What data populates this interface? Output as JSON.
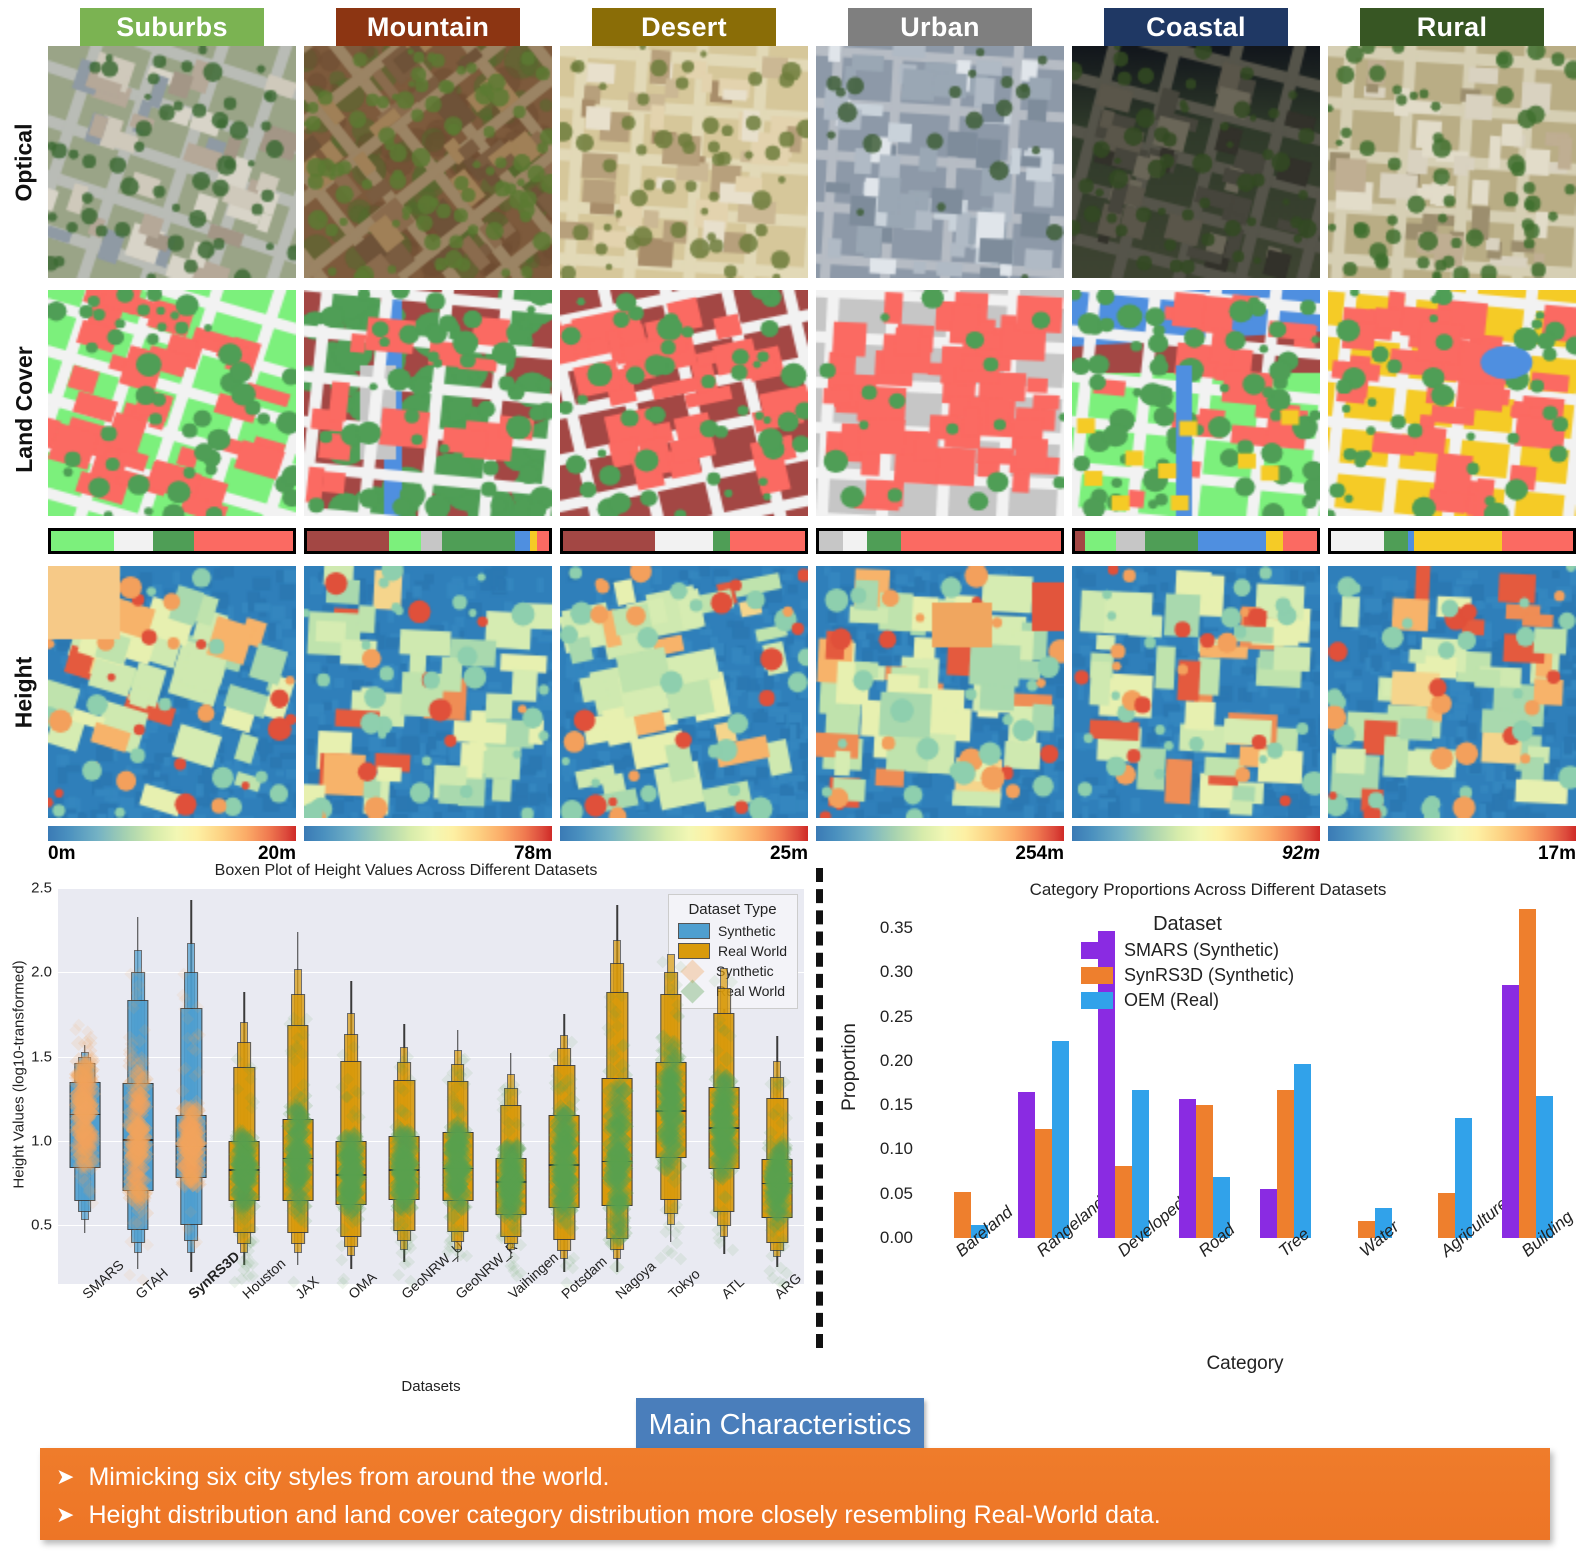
{
  "grid": {
    "row_labels": [
      "Optical",
      "Land Cover",
      "Height"
    ],
    "columns": [
      {
        "name": "Suburbs",
        "color": "#7bb352",
        "height_min": "0m",
        "height_max": "20m",
        "legend": [
          [
            "#7cf07c",
            0.26
          ],
          [
            "#f2f2f2",
            0.16
          ],
          [
            "#4f9e56",
            0.17
          ],
          [
            "#fb6a62",
            0.41
          ]
        ]
      },
      {
        "name": "Mountain",
        "color": "#8c3512",
        "height_min": "",
        "height_max": "78m",
        "legend": [
          [
            "#a34744",
            0.34
          ],
          [
            "#7cf07c",
            0.13
          ],
          [
            "#c6c6c6",
            0.09
          ],
          [
            "#4f9e56",
            0.3
          ],
          [
            "#4f8fe0",
            0.06
          ],
          [
            "#f5cb26",
            0.03
          ],
          [
            "#fb6a62",
            0.05
          ]
        ]
      },
      {
        "name": "Desert",
        "color": "#8a6d07",
        "height_min": "",
        "height_max": "25m",
        "legend": [
          [
            "#a34744",
            0.38
          ],
          [
            "#f2f2f2",
            0.24
          ],
          [
            "#4f9e56",
            0.07
          ],
          [
            "#fb6a62",
            0.31
          ]
        ]
      },
      {
        "name": "Urban",
        "color": "#7f7f7f",
        "height_min": "",
        "height_max": "254m",
        "legend": [
          [
            "#c6c6c6",
            0.1
          ],
          [
            "#f2f2f2",
            0.1
          ],
          [
            "#4f9e56",
            0.14
          ],
          [
            "#fb6a62",
            0.66
          ]
        ]
      },
      {
        "name": "Coastal",
        "color": "#1f3864",
        "height_min": "",
        "height_max": "92m",
        "legend": [
          [
            "#a34744",
            0.04
          ],
          [
            "#7cf07c",
            0.13
          ],
          [
            "#c6c6c6",
            0.12
          ],
          [
            "#4f9e56",
            0.22
          ],
          [
            "#4f8fe0",
            0.28
          ],
          [
            "#f5cb26",
            0.07
          ],
          [
            "#fb6a62",
            0.14
          ]
        ]
      },
      {
        "name": "Rural",
        "color": "#375623",
        "height_min": "",
        "height_max": "17m",
        "legend": [
          [
            "#f2f2f2",
            0.22
          ],
          [
            "#4f9e56",
            0.1
          ],
          [
            "#4f8fe0",
            0.025
          ],
          [
            "#f5cb26",
            0.36
          ],
          [
            "#fb6a62",
            0.295
          ]
        ]
      }
    ]
  },
  "chart_data": [
    {
      "type": "boxen",
      "title": "Boxen Plot of Height Values Across Different Datasets",
      "xlabel": "Datasets",
      "ylabel": "Height Values (log10-transformed)",
      "ylim": [
        0.15,
        2.5
      ],
      "yticks": [
        "0.5",
        "1.0",
        "1.5",
        "2.0",
        "2.5"
      ],
      "ytickvals": [
        0.5,
        1.0,
        1.5,
        2.0,
        2.5
      ],
      "grid": true,
      "legend_title": "Dataset Type",
      "legend": [
        {
          "label": "Synthetic",
          "color": "#4f9fd0",
          "marker": "box"
        },
        {
          "label": "Real World",
          "color": "#d99a0b",
          "marker": "box"
        },
        {
          "label": "Synthetic",
          "color": "#f2a45c",
          "marker": "diamond"
        },
        {
          "label": "Real World",
          "color": "#59a14f",
          "marker": "diamond"
        }
      ],
      "categories": [
        "SMARS",
        "GTAH",
        "SynRS3D",
        "Houston",
        "JAX",
        "OMA",
        "GeoNRW_U",
        "GeoNRW_R",
        "Vaihingen",
        "Potsdam",
        "Nagoya",
        "Tokyo",
        "ATL",
        "ARG"
      ],
      "bold_category": "SynRS3D",
      "series": [
        {
          "name": "SMARS",
          "type": "Synthetic",
          "median": 1.16,
          "q1": 0.84,
          "q3": 1.35,
          "lo": 0.45,
          "hi": 1.57
        },
        {
          "name": "GTAH",
          "type": "Synthetic",
          "median": 1.01,
          "q1": 0.7,
          "q3": 1.34,
          "lo": 0.24,
          "hi": 2.33
        },
        {
          "name": "SynRS3D",
          "type": "Synthetic",
          "median": 0.97,
          "q1": 0.78,
          "q3": 1.15,
          "lo": 0.22,
          "hi": 2.43
        },
        {
          "name": "Houston",
          "type": "Real World",
          "median": 0.83,
          "q1": 0.64,
          "q3": 1.0,
          "lo": 0.26,
          "hi": 1.88
        },
        {
          "name": "JAX",
          "type": "Real World",
          "median": 0.9,
          "q1": 0.64,
          "q3": 1.13,
          "lo": 0.26,
          "hi": 2.24
        },
        {
          "name": "OMA",
          "type": "Real World",
          "median": 0.8,
          "q1": 0.62,
          "q3": 1.0,
          "lo": 0.24,
          "hi": 1.95
        },
        {
          "name": "GeoNRW_U",
          "type": "Real World",
          "median": 0.83,
          "q1": 0.65,
          "q3": 1.03,
          "lo": 0.28,
          "hi": 1.69
        },
        {
          "name": "GeoNRW_R",
          "type": "Real World",
          "median": 0.84,
          "q1": 0.64,
          "q3": 1.05,
          "lo": 0.28,
          "hi": 1.66
        },
        {
          "name": "Vaihingen",
          "type": "Real World",
          "median": 0.76,
          "q1": 0.56,
          "q3": 0.9,
          "lo": 0.3,
          "hi": 1.52
        },
        {
          "name": "Potsdam",
          "type": "Real World",
          "median": 0.86,
          "q1": 0.6,
          "q3": 1.15,
          "lo": 0.22,
          "hi": 1.75
        },
        {
          "name": "Nagoya",
          "type": "Real World",
          "median": 0.88,
          "q1": 0.61,
          "q3": 1.37,
          "lo": 0.22,
          "hi": 2.4
        },
        {
          "name": "Tokyo",
          "type": "Real World",
          "median": 1.18,
          "q1": 0.9,
          "q3": 1.47,
          "lo": 0.4,
          "hi": 2.27
        },
        {
          "name": "ATL",
          "type": "Real World",
          "median": 1.08,
          "q1": 0.83,
          "q3": 1.32,
          "lo": 0.33,
          "hi": 2.2
        },
        {
          "name": "ARG",
          "type": "Real World",
          "median": 0.75,
          "q1": 0.54,
          "q3": 0.89,
          "lo": 0.25,
          "hi": 1.62
        }
      ]
    },
    {
      "type": "bar",
      "title": "Category Proportions Across Different Datasets",
      "xlabel": "Category",
      "ylabel": "Proportion",
      "ylim": [
        0,
        0.375
      ],
      "yticks": [
        "0.00",
        "0.05",
        "0.10",
        "0.15",
        "0.20",
        "0.25",
        "0.30",
        "0.35"
      ],
      "ytickvals": [
        0.0,
        0.05,
        0.1,
        0.15,
        0.2,
        0.25,
        0.3,
        0.35
      ],
      "grid": false,
      "legend_title": "Dataset",
      "legend_position": "upper-center",
      "categories": [
        "Bareland",
        "Rangeland",
        "Developed",
        "Road",
        "Tree",
        "Water",
        "Agriculture",
        "Building"
      ],
      "series": [
        {
          "name": "SMARS (Synthetic)",
          "color": "#8a2be2",
          "values": [
            0.0,
            0.165,
            0.347,
            0.157,
            0.055,
            0.0,
            0.0,
            0.286
          ]
        },
        {
          "name": "SynRS3D (Synthetic)",
          "color": "#ee7f2d",
          "values": [
            0.052,
            0.123,
            0.081,
            0.15,
            0.167,
            0.019,
            0.051,
            0.372
          ]
        },
        {
          "name": "OEM (Real)",
          "color": "#31a2ea",
          "values": [
            0.015,
            0.223,
            0.167,
            0.069,
            0.197,
            0.034,
            0.136,
            0.16
          ]
        }
      ]
    }
  ],
  "main_characteristics": {
    "badge": "Main Characteristics",
    "bullets": [
      "Mimicking six city styles from around the world.",
      "Height distribution and land cover category distribution more closely resembling Real-World data."
    ],
    "arrow": "➤"
  }
}
